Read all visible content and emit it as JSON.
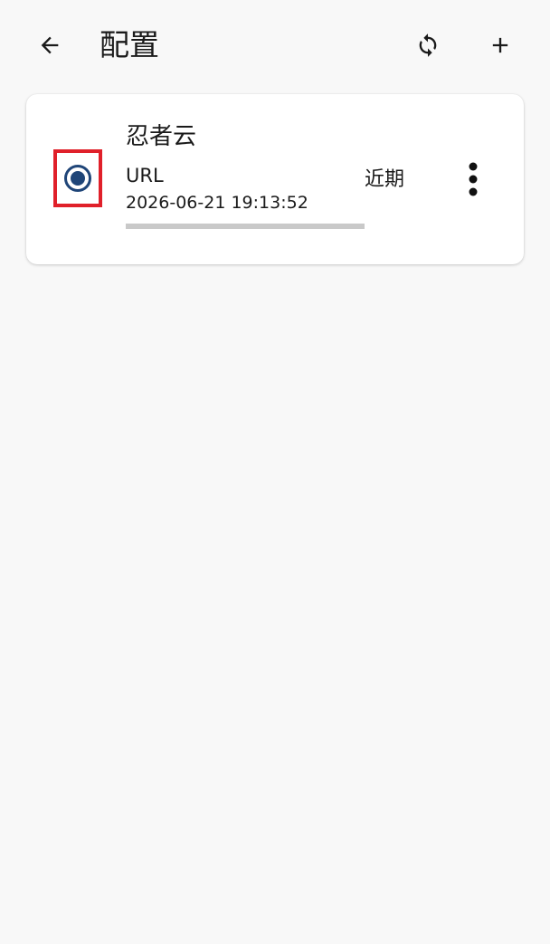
{
  "header": {
    "title": "配置",
    "back_icon": "arrow-left-icon",
    "refresh_icon": "sync-icon",
    "add_icon": "plus-icon"
  },
  "profiles": [
    {
      "name": "忍者云",
      "type": "URL",
      "updated": "2026-06-21 19:13:52",
      "status": "近期",
      "selected": true,
      "progress": 1.0,
      "menu_icon": "more-vertical-icon"
    }
  ],
  "colors": {
    "background": "#f8f8f8",
    "card": "#ffffff",
    "radio": "#1f4578",
    "highlight_box": "#e0202a",
    "progress": "#c9c9c9"
  }
}
